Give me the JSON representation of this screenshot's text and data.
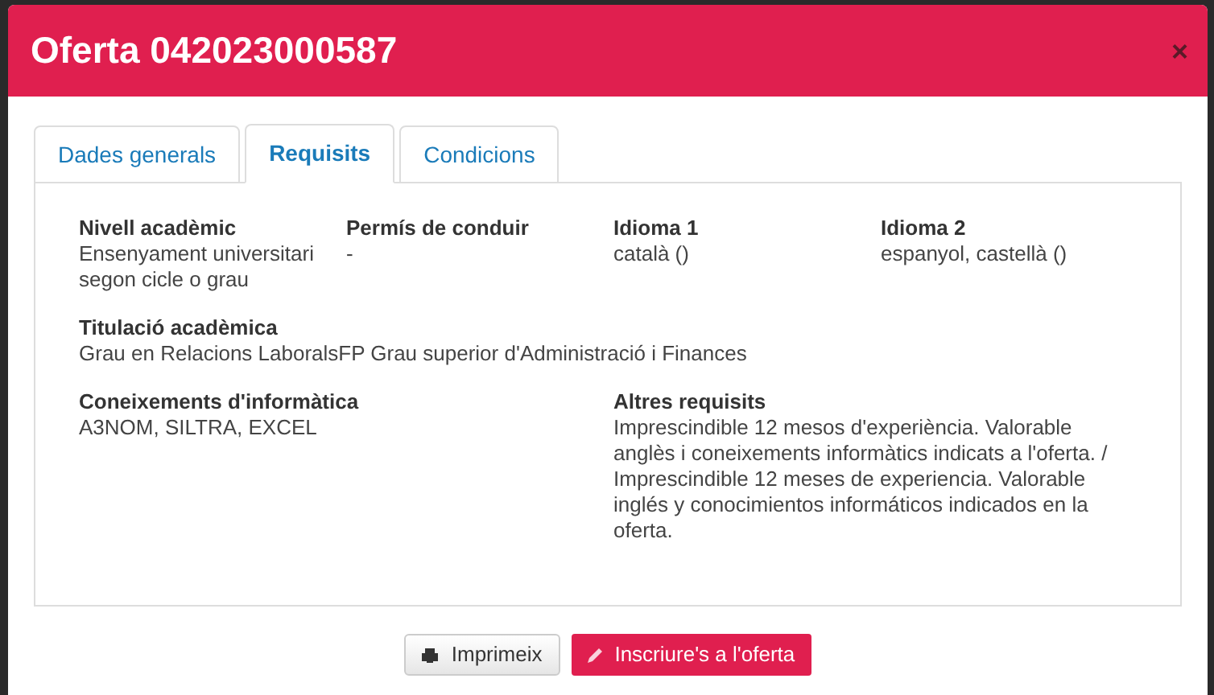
{
  "dialog": {
    "title": "Oferta 042023000587",
    "close": "×"
  },
  "tabs": [
    {
      "label": "Dades generals",
      "selected": false
    },
    {
      "label": "Requisits",
      "selected": true
    },
    {
      "label": "Condicions",
      "selected": false
    }
  ],
  "field_rows": [
    [
      {
        "label": "Nivell acadèmic",
        "value": "Ensenyament universitari segon cicle o grau"
      },
      {
        "label": "Permís de conduir",
        "value": "-"
      },
      {
        "label": "Idioma 1",
        "value": "català ()"
      },
      {
        "label": "Idioma 2",
        "value": "espanyol, castellà ()"
      }
    ],
    [
      {
        "label": "Titulació acadèmica",
        "value": "Grau en Relacions LaboralsFP Grau superior d'Administració i Finances"
      }
    ],
    [
      {
        "label": "Coneixements d'informàtica",
        "value": "A3NOM, SILTRA, EXCEL"
      },
      {
        "label": "Altres requisits",
        "value": "Imprescindible 12 mesos d'experiència. Valorable anglès i coneixements informàtics indicats a l'oferta. / Imprescindible 12 meses de experiencia. Valorable inglés y conocimientos informáticos indicados en la oferta."
      }
    ]
  ],
  "buttons": [
    {
      "label": "Imprimeix",
      "kind": "print"
    },
    {
      "label": "Inscriure's a l'oferta",
      "kind": "apply"
    }
  ]
}
